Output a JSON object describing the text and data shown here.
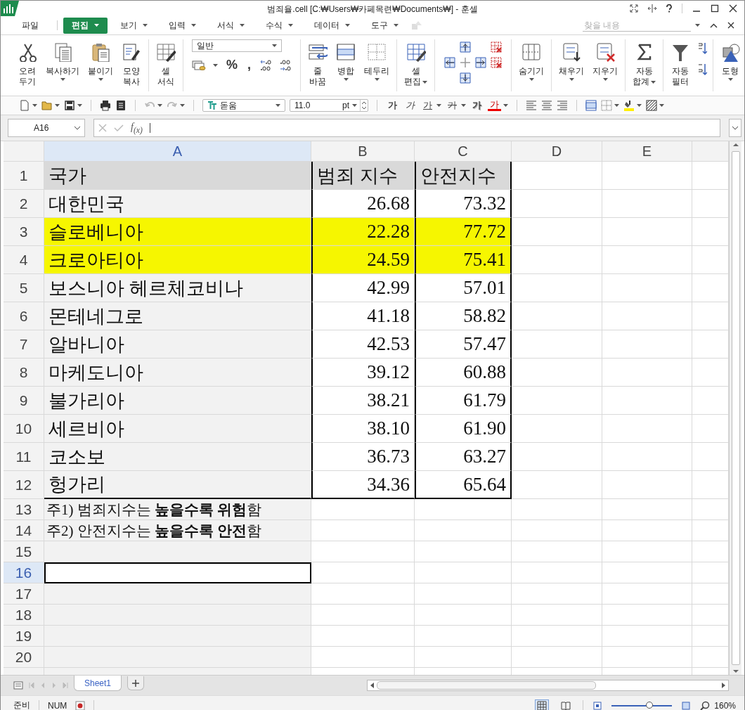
{
  "window": {
    "title": "범죄율.cell [C:₩Users₩카페목련₩Documents₩] - 훈셀"
  },
  "menu": [
    {
      "label": "파일",
      "selected": false,
      "caret": false
    },
    {
      "label": "편집",
      "selected": true,
      "caret": true
    },
    {
      "label": "보기",
      "selected": false,
      "caret": true
    },
    {
      "label": "입력",
      "selected": false,
      "caret": true
    },
    {
      "label": "서식",
      "selected": false,
      "caret": true
    },
    {
      "label": "수식",
      "selected": false,
      "caret": true
    },
    {
      "label": "데이터",
      "selected": false,
      "caret": true
    },
    {
      "label": "도구",
      "selected": false,
      "caret": true
    }
  ],
  "search": {
    "placeholder": "찾을 내용"
  },
  "ribbon": {
    "groups": [
      {
        "kind": "buttons",
        "items": [
          {
            "kind": "button",
            "lines": [
              "오려",
              "두기"
            ],
            "caret": false
          },
          {
            "kind": "button",
            "lines": [
              "복사하기"
            ],
            "caret": true
          },
          {
            "kind": "button",
            "lines": [
              "붙이기"
            ],
            "caret": true
          },
          {
            "kind": "button",
            "lines": [
              "모양",
              "복사"
            ],
            "caret": false
          }
        ]
      },
      {
        "kind": "buttons",
        "items": [
          {
            "kind": "button",
            "lines": [
              "셀",
              "서식"
            ],
            "caret": false
          }
        ]
      },
      {
        "kind": "number",
        "number_format": "일반",
        "symbols": [
          "%",
          ","
        ]
      },
      {
        "kind": "buttons",
        "items": [
          {
            "kind": "button",
            "lines": [
              "줄",
              "바꿈"
            ],
            "caret": false
          },
          {
            "kind": "button",
            "lines": [
              "병합"
            ],
            "caret": true
          },
          {
            "kind": "button",
            "lines": [
              "테두리"
            ],
            "caret": true
          }
        ]
      },
      {
        "kind": "buttons",
        "items": [
          {
            "kind": "button",
            "lines": [
              "셀",
              "편집"
            ],
            "caret": true
          }
        ]
      },
      {
        "kind": "cells"
      },
      {
        "kind": "buttons",
        "items": [
          {
            "kind": "button",
            "lines": [
              "숨기기"
            ],
            "caret": true
          }
        ]
      },
      {
        "kind": "buttons",
        "items": [
          {
            "kind": "button",
            "lines": [
              "채우기"
            ],
            "caret": true
          },
          {
            "kind": "button",
            "lines": [
              "지우기"
            ],
            "caret": true
          }
        ]
      },
      {
        "kind": "buttons",
        "items": [
          {
            "kind": "button",
            "lines": [
              "자동",
              "합계"
            ],
            "caret": true
          }
        ]
      },
      {
        "kind": "buttons",
        "items": [
          {
            "kind": "button",
            "lines": [
              "자동",
              "필터"
            ],
            "caret": false
          },
          {
            "kind": "sort"
          }
        ]
      },
      {
        "kind": "buttons",
        "items": [
          {
            "kind": "button",
            "lines": [
              "도형"
            ],
            "caret": true
          }
        ]
      }
    ]
  },
  "toolbar": {
    "font": "돋움",
    "size": "11.0",
    "unit": "pt",
    "styles": [
      {
        "label": "가",
        "kind": "bold"
      },
      {
        "label": "가",
        "kind": "italic"
      },
      {
        "label": "가",
        "kind": "underline"
      },
      {
        "label": "가",
        "kind": "strike"
      },
      {
        "label": "가",
        "kind": "shadow"
      },
      {
        "label": "가",
        "kind": "color"
      }
    ]
  },
  "formula_bar": {
    "cell_ref": "A16",
    "function_label": "f$_{(x)}$"
  },
  "sheet": {
    "columns": [
      {
        "label": "A",
        "selected": true
      },
      {
        "label": "B",
        "selected": false
      },
      {
        "label": "C",
        "selected": false
      },
      {
        "label": "D",
        "selected": false
      },
      {
        "label": "E",
        "selected": false
      }
    ],
    "rows": [
      {
        "number": "1",
        "kind": "header",
        "selected": false,
        "cells": [
          "국가",
          "범죄 지수",
          "안전지수"
        ]
      },
      {
        "number": "2",
        "kind": "data",
        "selected": false,
        "highlighted": false,
        "cells": [
          "대한민국",
          "26.68",
          "73.32"
        ]
      },
      {
        "number": "3",
        "kind": "data",
        "selected": false,
        "highlighted": true,
        "cells": [
          "슬로베니아",
          "22.28",
          "77.72"
        ]
      },
      {
        "number": "4",
        "kind": "data",
        "selected": false,
        "highlighted": true,
        "cells": [
          "크로아티아",
          "24.59",
          "75.41"
        ]
      },
      {
        "number": "5",
        "kind": "data",
        "selected": false,
        "highlighted": false,
        "cells": [
          "보스니아 헤르체코비나",
          "42.99",
          "57.01"
        ]
      },
      {
        "number": "6",
        "kind": "data",
        "selected": false,
        "highlighted": false,
        "cells": [
          "몬테네그로",
          "41.18",
          "58.82"
        ]
      },
      {
        "number": "7",
        "kind": "data",
        "selected": false,
        "highlighted": false,
        "cells": [
          "알바니아",
          "42.53",
          "57.47"
        ]
      },
      {
        "number": "8",
        "kind": "data",
        "selected": false,
        "highlighted": false,
        "cells": [
          "마케도니아",
          "39.12",
          "60.88"
        ]
      },
      {
        "number": "9",
        "kind": "data",
        "selected": false,
        "highlighted": false,
        "cells": [
          "불가리아",
          "38.21",
          "61.79"
        ]
      },
      {
        "number": "10",
        "kind": "data",
        "selected": false,
        "highlighted": false,
        "cells": [
          "세르비아",
          "38.10",
          "61.90"
        ]
      },
      {
        "number": "11",
        "kind": "data",
        "selected": false,
        "highlighted": false,
        "cells": [
          "코소보",
          "36.73",
          "63.27"
        ]
      },
      {
        "number": "12",
        "kind": "data",
        "selected": false,
        "highlighted": false,
        "cells": [
          "헝가리",
          "34.36",
          "65.64"
        ]
      },
      {
        "number": "13",
        "kind": "note",
        "selected": false,
        "cells": [
          "주1) 범죄지수는 **높을수록 위험**함"
        ]
      },
      {
        "number": "14",
        "kind": "note",
        "selected": false,
        "cells": [
          "주2) 안전지수는 **높을수록 안전**함"
        ]
      },
      {
        "number": "15",
        "kind": "empty",
        "selected": false
      },
      {
        "number": "16",
        "kind": "empty",
        "selected": true
      },
      {
        "number": "17",
        "kind": "empty",
        "selected": false
      },
      {
        "number": "18",
        "kind": "empty",
        "selected": false
      },
      {
        "number": "19",
        "kind": "empty",
        "selected": false
      },
      {
        "number": "20",
        "kind": "empty",
        "selected": false
      }
    ]
  },
  "tabs": [
    {
      "label": "Sheet1",
      "selected": true
    }
  ],
  "status_bar": {
    "mode": "준비",
    "num": "NUM",
    "zoom": {
      "level": 0.62
    },
    "zoom_text": "160%"
  }
}
